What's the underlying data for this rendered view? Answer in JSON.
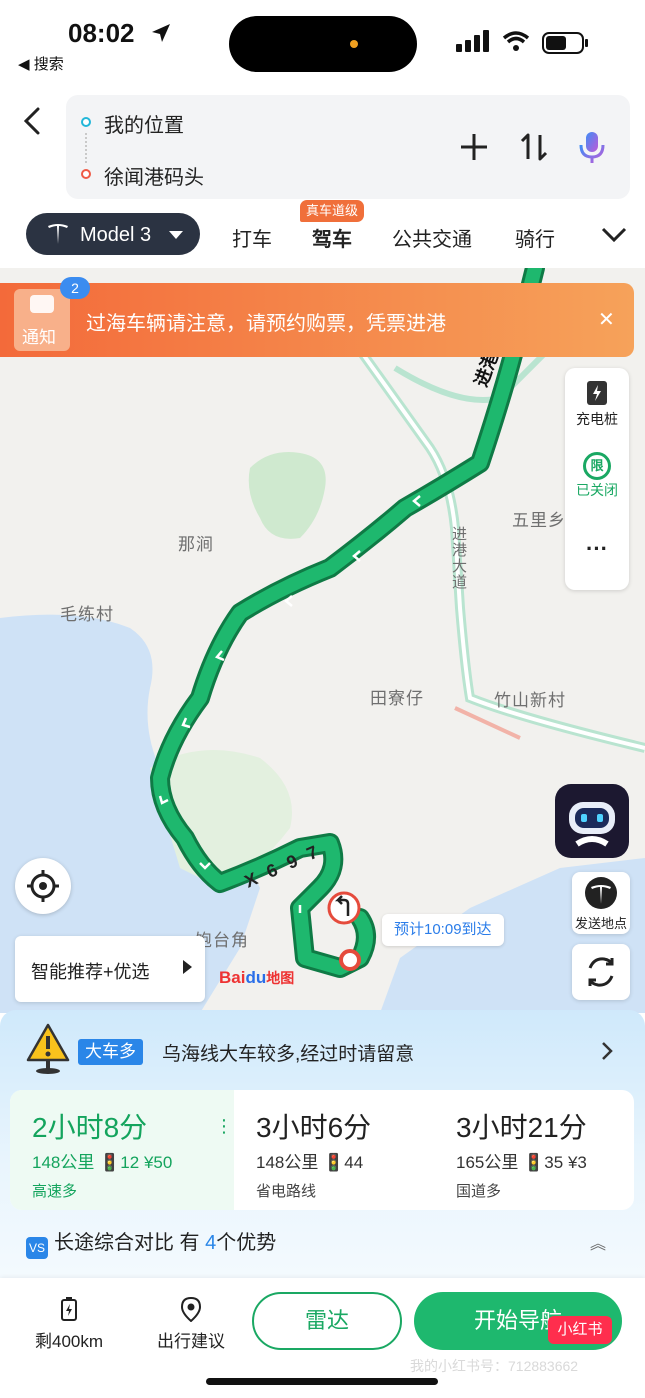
{
  "status_bar": {
    "time": "08:02",
    "back_app": "◀ 搜索"
  },
  "route_input": {
    "origin": "我的位置",
    "destination": "徐闻港码头"
  },
  "vehicle": {
    "label": "Model 3"
  },
  "modes": [
    {
      "label": "打车"
    },
    {
      "label": "驾车",
      "badge": "真车道级"
    },
    {
      "label": "公共交通"
    },
    {
      "label": "骑行"
    }
  ],
  "notice": {
    "label": "通知",
    "count": "2",
    "text": "过海车辆请注意，请预约购票，凭票进港"
  },
  "side_panel": {
    "charging": "充电桩",
    "limit_icon": "限",
    "limit": "已关闭",
    "more": "···"
  },
  "map": {
    "labels": [
      "那涧",
      "毛练村",
      "五里乡",
      "田寮仔",
      "竹山新村",
      "饱台角",
      "进港大道",
      "进港大道"
    ],
    "road_label": "X697",
    "eta": "预计10:09到达",
    "logo": "Bai地图",
    "send_location": "发送地点",
    "smart_recommend": "智能推荐+优选"
  },
  "alert": {
    "tag": "大车多",
    "text": "乌海线大车较多,经过时请留意"
  },
  "routes": [
    {
      "duration": "2小时8分",
      "distance": "148公里",
      "lights": "12",
      "toll": "¥50",
      "tag": "高速多"
    },
    {
      "duration": "3小时6分",
      "distance": "148公里",
      "lights": "44",
      "tag": "省电路线"
    },
    {
      "duration": "3小时21分",
      "distance": "165公里",
      "lights": "35",
      "toll": "¥3",
      "tag": "国道多"
    }
  ],
  "compare": {
    "vs": "VS",
    "prefix": "长途综合对比 有",
    "count": "4",
    "suffix": "个优势"
  },
  "bottom": {
    "range": "剩400km",
    "advice": "出行建议",
    "radar": "雷达",
    "start": "开始导航"
  },
  "watermark": {
    "badge": "小红书",
    "text": "我的小红书号：712883662"
  },
  "colors": {
    "route": "#1eb86e",
    "accent": "#2a86e8",
    "notice": "#f36a3a"
  }
}
